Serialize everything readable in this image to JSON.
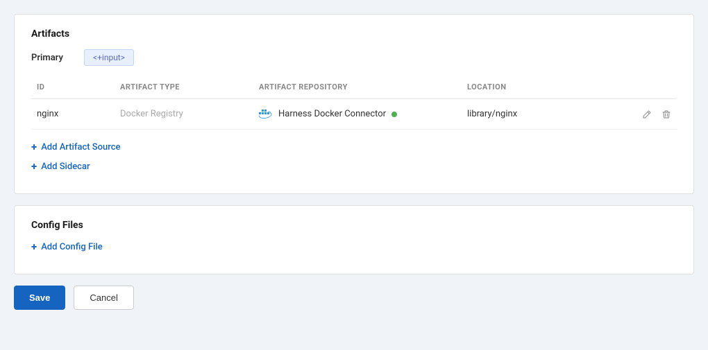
{
  "page": {
    "background": "#f0f4f8"
  },
  "artifacts_section": {
    "title": "Artifacts",
    "primary_label": "Primary",
    "input_tag": "<+input>",
    "table": {
      "headers": {
        "id": "ID",
        "artifact_type": "ARTIFACT TYPE",
        "artifact_repository": "ARTIFACT REPOSITORY",
        "location": "LOCATION"
      },
      "rows": [
        {
          "id": "nginx",
          "artifact_type": "Docker Registry",
          "artifact_repository": "Harness Docker Connector",
          "status": "connected",
          "location": "library/nginx"
        }
      ]
    },
    "add_artifact_label": "Add Artifact Source",
    "add_sidecar_label": "Add Sidecar"
  },
  "config_files_section": {
    "title": "Config Files",
    "add_config_label": "Add Config File"
  },
  "footer": {
    "save_label": "Save",
    "cancel_label": "Cancel"
  }
}
